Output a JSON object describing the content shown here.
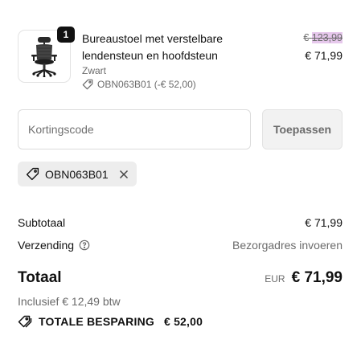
{
  "line_item": {
    "quantity": "1",
    "title": "Bureaustoel met verstelbare lendensteun en hoofdsteun",
    "variant": "Zwart",
    "discount_code": "OBN063B01 (-€ 52,00)",
    "price_original_prefix": "€ ",
    "price_original_value": "123,99",
    "price_current": "€ 71,99",
    "image_icon": "office-chair-icon"
  },
  "discount": {
    "placeholder": "Kortingscode",
    "value": "",
    "apply_label": "Toepassen",
    "applied_code": "OBN063B01"
  },
  "summary": {
    "subtotal_label": "Subtotaal",
    "subtotal_value": "€ 71,99",
    "shipping_label": "Verzending",
    "shipping_value": "Bezorgadres invoeren",
    "total_label": "Totaal",
    "currency": "EUR",
    "total_value": "€ 71,99",
    "tax_note": "Inclusief € 12,49 btw",
    "savings_label": "TOTALE BESPARING",
    "savings_value": "€ 52,00"
  },
  "colors": {
    "badge": "#111111",
    "muted_text": "#6b6b6b",
    "price_highlight": "#e6c8ec",
    "chip_bg": "#ededed",
    "button_bg": "#f2f2f2"
  }
}
